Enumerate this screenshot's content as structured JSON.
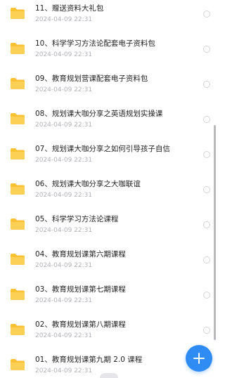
{
  "icons": {
    "folder": "folder-icon",
    "add": "plus-icon",
    "select": "radio-circle-icon"
  },
  "colors": {
    "folder_yellow": "#f8c233",
    "accent_blue": "#2f8cf5",
    "name_text": "#222222",
    "date_text": "#b3b3b8"
  },
  "files": [
    {
      "name": "11、赠送资料大礼包",
      "date": "2024-04-09 22:31"
    },
    {
      "name": "10、科学学习方法论配套电子资料包",
      "date": "2024-04-09 22:31"
    },
    {
      "name": "09、教育规划营课配套电子资料包",
      "date": "2024-04-09 22:31"
    },
    {
      "name": "08、规划课大咖分享之英语规划实操课",
      "date": "2024-04-09 22:31"
    },
    {
      "name": "07、规划课大咖分享之如何引导孩子自信",
      "date": "2024-04-09 22:31"
    },
    {
      "name": "06、规划课大咖分享之大咖联谊",
      "date": "2024-04-09 22:31"
    },
    {
      "name": "05、科学学习方法论课程",
      "date": "2024-04-09 22:31"
    },
    {
      "name": "04、教育规划课第六期课程",
      "date": "2024-04-09 22:31"
    },
    {
      "name": "03、教育规划课第七期课程",
      "date": "2024-04-09 22:31"
    },
    {
      "name": "02、教育规划课第八期课程",
      "date": "2024-04-09 22:31"
    },
    {
      "name": "01、教育规划课第九期 2.0 课程",
      "date": "2024-04-09 22:31"
    }
  ]
}
